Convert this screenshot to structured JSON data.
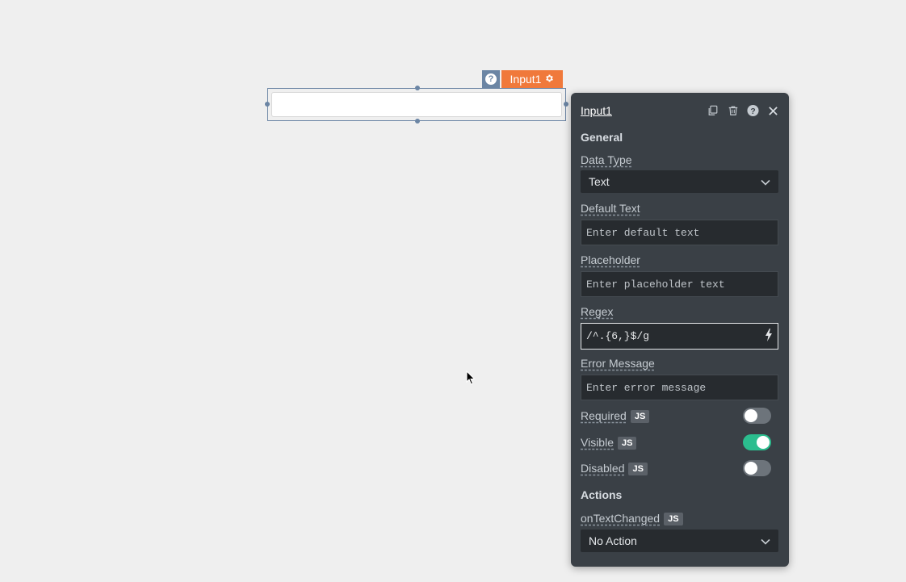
{
  "widget": {
    "name": "Input1",
    "help_glyph": "?"
  },
  "pane": {
    "title": "Input1",
    "general_section": "General",
    "data_type": {
      "label": "Data Type",
      "value": "Text"
    },
    "default_text": {
      "label": "Default Text",
      "placeholder": "Enter default text"
    },
    "placeholder": {
      "label": "Placeholder",
      "placeholder": "Enter placeholder text"
    },
    "regex": {
      "label": "Regex",
      "value": "/^.{6,}$/g"
    },
    "error_message": {
      "label": "Error Message",
      "placeholder": "Enter error message"
    },
    "required": {
      "label": "Required",
      "badge": "JS",
      "on": false
    },
    "visible": {
      "label": "Visible",
      "badge": "JS",
      "on": true
    },
    "disabled": {
      "label": "Disabled",
      "badge": "JS",
      "on": false
    },
    "actions_section": "Actions",
    "on_text_changed": {
      "label": "onTextChanged",
      "badge": "JS",
      "value": "No Action"
    }
  },
  "colors": {
    "accent_orange": "#f0793b",
    "toggle_on": "#2bbd8e",
    "pane_bg": "#3a4046",
    "selection_blue": "#6b85a4"
  }
}
